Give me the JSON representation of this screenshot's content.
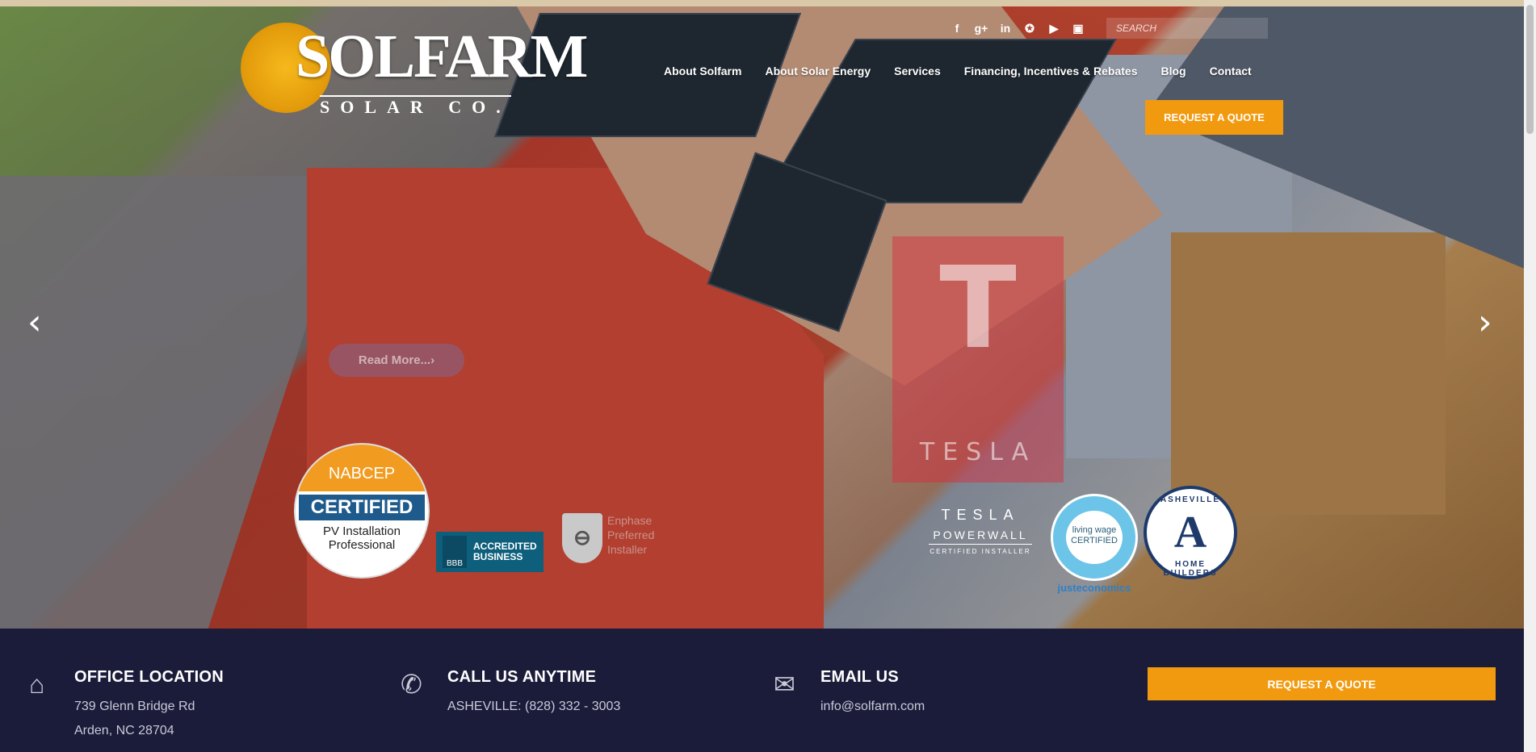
{
  "brand": {
    "name": "SOLFARM",
    "tagline": "SOLAR CO."
  },
  "nav": {
    "items": [
      "About Solfarm",
      "About Solar Energy",
      "Services",
      "Financing, Incentives & Rebates",
      "Blog",
      "Contact"
    ],
    "quote_button": "REQUEST A QUOTE"
  },
  "social": [
    "facebook-icon",
    "google-plus-icon",
    "linkedin-icon",
    "twitter-icon",
    "youtube-icon",
    "instagram-icon"
  ],
  "search": {
    "placeholder": "SEARCH"
  },
  "hero": {
    "read_more": "Read More...",
    "tesla_overlay_word": "TESLA",
    "carousel_prev": "prev-arrow-icon",
    "carousel_next": "next-arrow-icon"
  },
  "badges": {
    "nabcep": {
      "top": "NABCEP",
      "mid": "CERTIFIED",
      "bottom_line1": "PV Installation",
      "bottom_line2": "Professional"
    },
    "bbb": {
      "line1": "ACCREDITED",
      "line2": "BUSINESS"
    },
    "enphase": {
      "line1": "Enphase",
      "line2": "Preferred",
      "line3": "Installer"
    },
    "powerwall": {
      "brand": "TESLA",
      "product": "POWERWALL",
      "caption": "CERTIFIED INSTALLER"
    },
    "living_wage": {
      "line1": "living wage",
      "line2": "CERTIFIED",
      "foot": "justeconomics"
    },
    "ahb": {
      "top": "ASHEVILLE",
      "bottom": "HOME BUILDERS"
    }
  },
  "footer": {
    "office": {
      "title": "OFFICE LOCATION",
      "line1": "739 Glenn Bridge Rd",
      "line2": "Arden, NC 28704"
    },
    "phone": {
      "title": "CALL US ANYTIME",
      "line1": "ASHEVILLE: (828) 332 - 3003"
    },
    "email": {
      "title": "EMAIL US",
      "line1": "info@solfarm.com"
    },
    "quote_button": "REQUEST A QUOTE"
  },
  "colors": {
    "accent": "#f29a0f",
    "footer_bg": "#1b1c3a",
    "overlay_red": "#dc283c"
  }
}
